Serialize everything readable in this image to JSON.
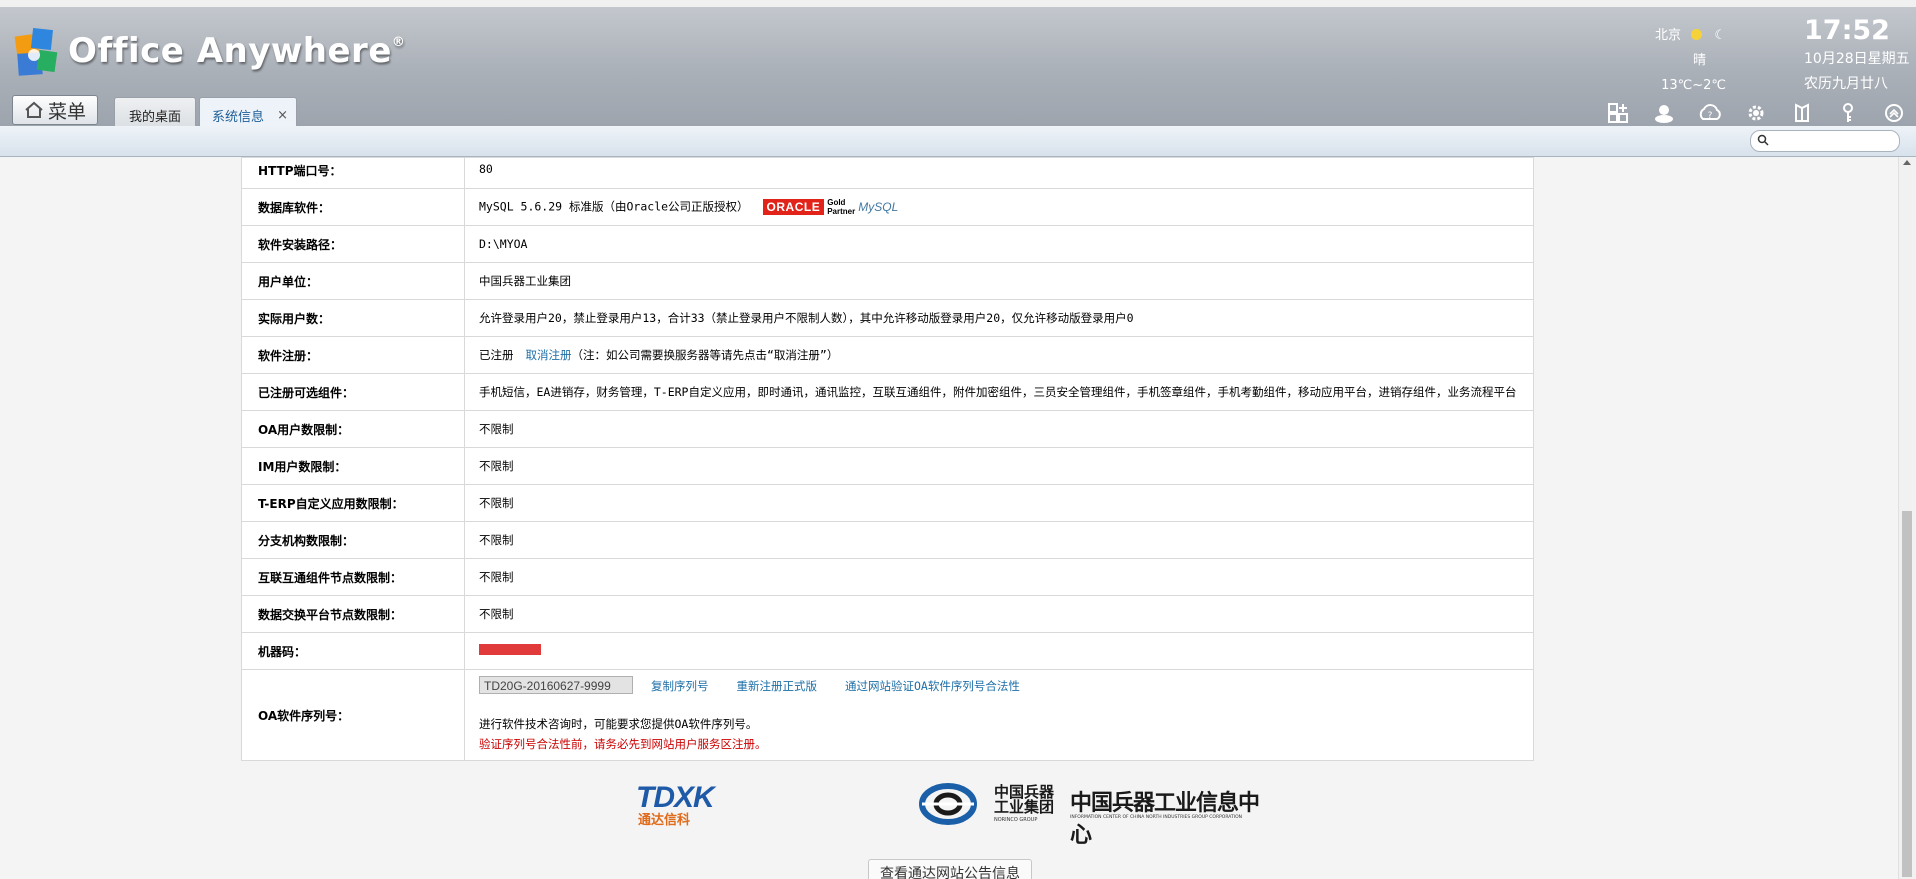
{
  "header": {
    "app_title": "Office Anywhere",
    "trademark": "®",
    "menu_label": "菜单",
    "tabs": [
      {
        "label": "我的桌面"
      },
      {
        "label": "系统信息",
        "close": "×"
      }
    ],
    "weather": {
      "city": "北京",
      "condition": "晴",
      "temperature": "13℃~2℃"
    },
    "clock": "17:52",
    "date": "10月28日星期五",
    "lunar_date": "农历九月廿八",
    "toolbar_icons": [
      "apps-icon",
      "user-status-icon",
      "help-icon",
      "settings-icon",
      "org-icon",
      "key-icon",
      "collapse-icon"
    ]
  },
  "search": {
    "placeholder": "",
    "value": ""
  },
  "info_rows": [
    {
      "label": "HTTP端口号：",
      "value": "80"
    },
    {
      "label": "数据库软件：",
      "value": "MySQL 5.6.29 标准版（由Oracle公司正版授权）"
    },
    {
      "label": "软件安装路径：",
      "value": "D:\\MYOA"
    },
    {
      "label": "用户单位：",
      "value": "中国兵器工业集团"
    },
    {
      "label": "实际用户数：",
      "value": "允许登录用户20，禁止登录用户13，合计33（禁止登录用户不限制人数），其中允许移动版登录用户20，仅允许移动版登录用户0"
    },
    {
      "label": "软件注册：",
      "value": "已注册",
      "link": "取消注册",
      "note": "（注：如公司需要换服务器等请先点击“取消注册”）"
    },
    {
      "label": "已注册可选组件：",
      "value": "手机短信，EA进销存，财务管理，T-ERP自定义应用，即时通讯，通讯监控，互联互通组件，附件加密组件，三员安全管理组件，手机签章组件，手机考勤组件，移动应用平台，进销存组件，业务流程平台"
    },
    {
      "label": "OA用户数限制：",
      "value": "不限制"
    },
    {
      "label": "IM用户数限制：",
      "value": "不限制"
    },
    {
      "label": "T-ERP自定义应用数限制：",
      "value": "不限制"
    },
    {
      "label": "分支机构数限制：",
      "value": "不限制"
    },
    {
      "label": "互联互通组件节点数限制：",
      "value": "不限制"
    },
    {
      "label": "数据交换平台节点数限制：",
      "value": "不限制"
    },
    {
      "label": "机器码：",
      "value": ""
    }
  ],
  "serial": {
    "label": "OA软件序列号：",
    "value": "TD20G-20160627-9999",
    "copy_link": "复制序列号",
    "reregister_link": "重新注册正式版",
    "verify_link": "通过网站验证OA软件序列号合法性",
    "tech_note": "进行软件技术咨询时，可能要求您提供OA软件序列号。",
    "warning": "验证序列号合法性前，请务必先到网站用户服务区注册。"
  },
  "oracle_badge": {
    "oracle": "ORACLE",
    "gold": "Gold",
    "partner": "Partner",
    "mysql": "MySQL"
  },
  "footer": {
    "tdxk_logo": "TDXK",
    "tdxk_sub": "通达信科",
    "norinco_cn": "中国兵器工业集团",
    "norinco_center": "中国兵器工业信息中心",
    "norinco_en": "NORINCO GROUP",
    "norinco_center_en": "INFORMATION CENTER OF CHINA NORTH INDUSTRIES GROUP CORPORATION",
    "notice_button": "查看通达网站公告信息"
  },
  "colors": {
    "link": "#1d6fa8",
    "warning": "#cc0000",
    "redbar": "#e03a3a",
    "oracle_red": "#e2231a"
  }
}
